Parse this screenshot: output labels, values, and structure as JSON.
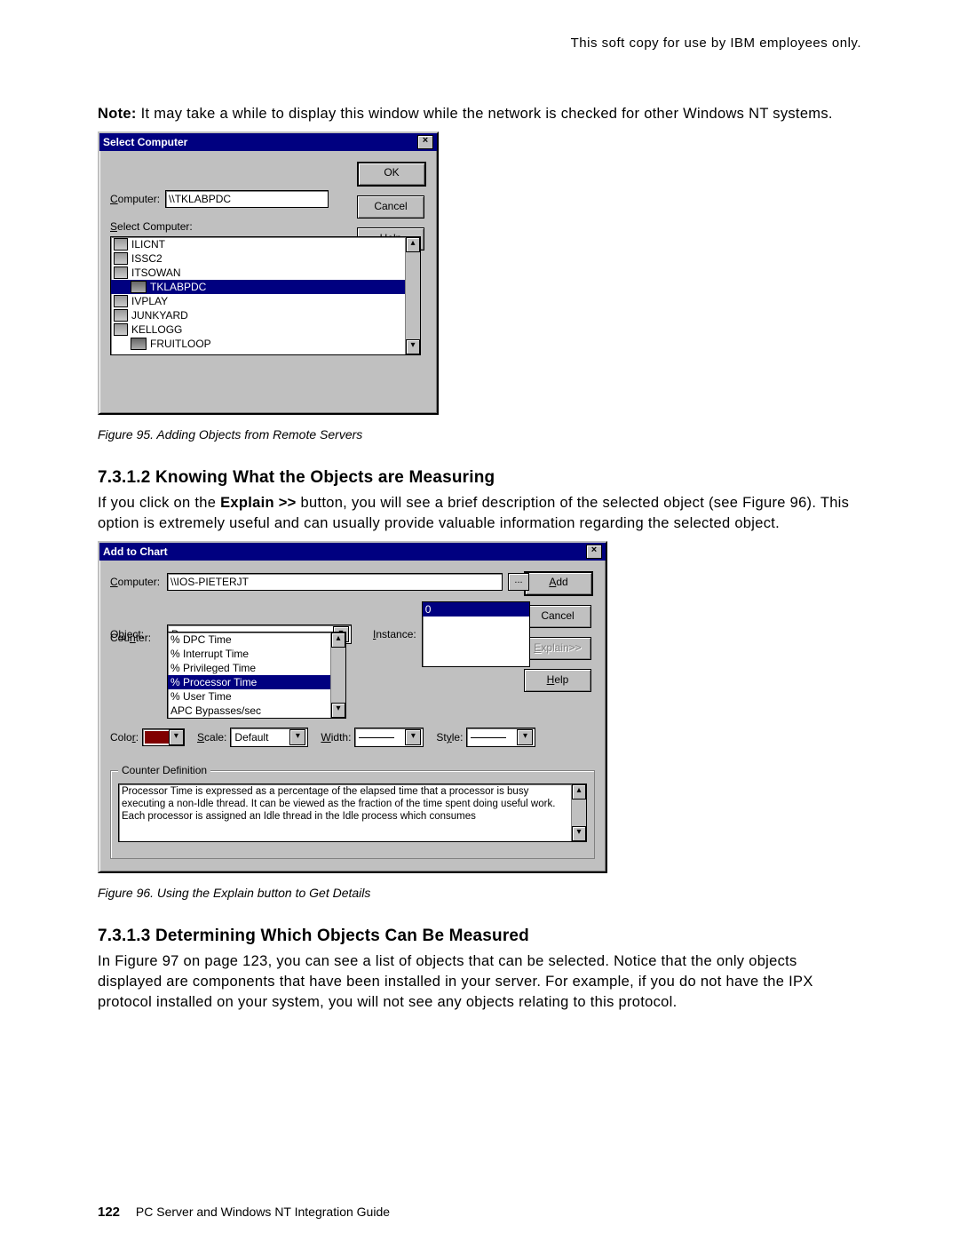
{
  "header_note": "This soft copy for use by IBM employees only.",
  "note": "It may take a while to display this window while the network is checked for other Windows NT systems.",
  "note_label": "Note:",
  "fig95": {
    "title": "Select Computer",
    "ok": "OK",
    "cancel": "Cancel",
    "help": "Help",
    "computer_label": "Computer:",
    "computer_value": "\\\\TKLABPDC",
    "select_label": "Select Computer:",
    "items": [
      "ILICNT",
      "ISSC2",
      "ITSOWAN",
      "TKLABPDC",
      "IVPLAY",
      "JUNKYARD",
      "KELLOGG",
      "FRUITLOOP"
    ],
    "selected_index": 3
  },
  "caption95": "Figure 95.  Adding Objects from Remote Servers",
  "sec712_heading": "7.3.1.2  Knowing What the Objects are Measuring",
  "sec712_body": "If you click on the Explain >> button,  you will see a brief description of the selected object (see Figure 96).  This option is extremely useful and can usually provide valuable information regarding the selected object.",
  "fig96": {
    "title": "Add to Chart",
    "computer_label": "Computer:",
    "computer_value": "\\\\IOS-PIETERJT",
    "object_label": "Object:",
    "object_value": "Processor",
    "instance_label": "Instance:",
    "instance_value": "0",
    "counter_label": "Counter:",
    "counters": [
      "% DPC Time",
      "% Interrupt Time",
      "% Privileged Time",
      "% Processor Time",
      "% User Time",
      "APC Bypasses/sec"
    ],
    "counter_selected_index": 3,
    "color_label": "Color:",
    "scale_label": "Scale:",
    "scale_value": "Default",
    "width_label": "Width:",
    "style_label": "Style:",
    "add": "Add",
    "cancel": "Cancel",
    "explain": "Explain>>",
    "help": "Help",
    "group_label": "Counter Definition",
    "definition": "Processor Time is expressed as a percentage of the elapsed time that a processor is busy executing a non-Idle thread.  It can be viewed as the fraction of the time spent doing useful work.  Each processor is assigned an Idle thread in the Idle process which consumes"
  },
  "caption96": "Figure 96.  Using the Explain button to Get Details",
  "sec713_heading": "7.3.1.3  Determining Which Objects Can Be Measured",
  "sec713_body": "In Figure 97 on page 123, you can see a list of objects that can be selected.  Notice that the only objects displayed are components that have been installed in your server.  For example, if you do not have the IPX protocol installed on your system, you will not see any objects relating to this protocol.",
  "footer_page": "122",
  "footer_text": "PC Server and Windows NT Integration Guide"
}
